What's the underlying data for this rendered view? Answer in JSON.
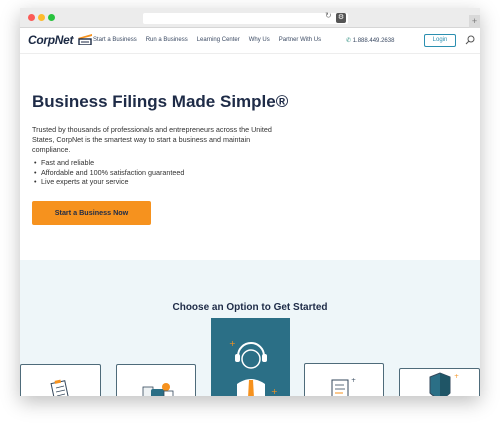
{
  "browser": {
    "reload_icon": "reload-icon",
    "extension_icon": "extension-icon",
    "new_tab_label": "+"
  },
  "header": {
    "logo_text": "CorpNet",
    "nav": [
      "Start a Business",
      "Run a Business",
      "Learning Center",
      "Why Us",
      "Partner With Us"
    ],
    "phone": "1.888.449.2638",
    "login_label": "Login",
    "search_icon": "search-icon"
  },
  "hero": {
    "title": "Business Filings Made Simple®",
    "description": "Trusted by thousands of professionals and entrepreneurs across the United States, CorpNet is the smartest way to start a business and maintain compliance.",
    "bullets": [
      "Fast and reliable",
      "Affordable and 100% satisfaction guaranteed",
      "Live experts at your service"
    ],
    "cta_label": "Start a Business Now"
  },
  "options": {
    "title": "Choose an Option to Get Started"
  },
  "colors": {
    "accent_orange": "#f6921e",
    "navy": "#1e2b47",
    "teal": "#2b6f86",
    "section_bg": "#eef6f9"
  }
}
